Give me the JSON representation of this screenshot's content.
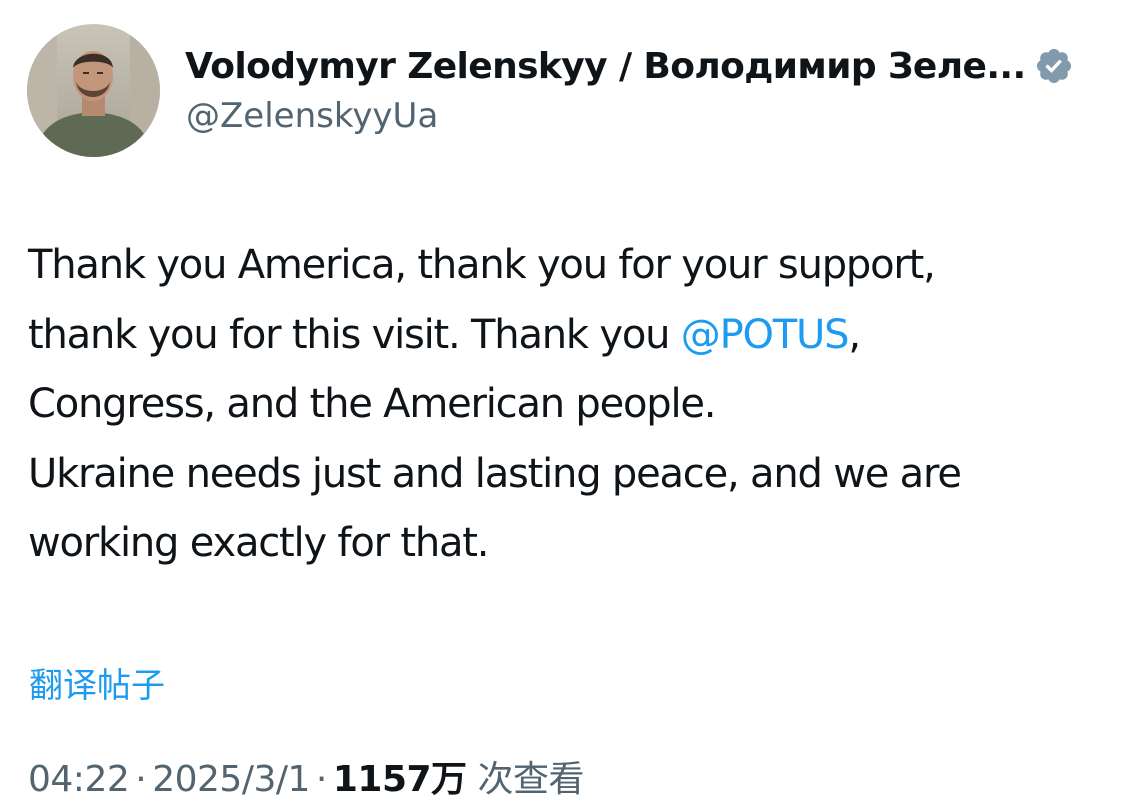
{
  "author": {
    "display_name": "Volodymyr Zelenskyy / Володимир Зеле...",
    "handle": "@ZelenskyyUa",
    "verified_icon": "verified-badge-icon",
    "verified_color": "#829aab"
  },
  "tweet": {
    "line1": "Thank you America, thank you for your support,",
    "line2_before": "thank you for this visit. Thank you ",
    "line2_mention": "@POTUS",
    "line2_after": ",",
    "line3": "Congress, and the American people.",
    "line4": "Ukraine needs just and lasting peace, and we are",
    "line5": "working exactly for that."
  },
  "translate_label": "翻译帖子",
  "meta": {
    "time": "04:22",
    "separator": "·",
    "date": "2025/3/1",
    "views_count": "1157万",
    "views_label": "次查看"
  },
  "colors": {
    "link": "#1d9bf0",
    "text": "#0f1419",
    "secondary": "#536471"
  }
}
